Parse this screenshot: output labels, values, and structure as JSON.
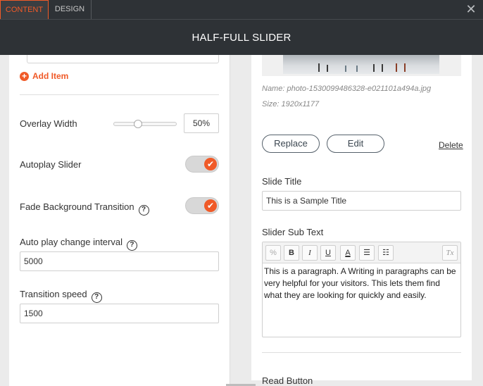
{
  "tabs": {
    "content": "CONTENT",
    "design": "DESIGN"
  },
  "window": {
    "close_glyph": "✕",
    "title": "HALF-FULL SLIDER"
  },
  "left": {
    "add_item": {
      "icon": "+",
      "label": "Add Item"
    },
    "overlay_width": {
      "label": "Overlay Width",
      "value": "50%",
      "level": 0.5
    },
    "autoplay": {
      "label": "Autoplay Slider",
      "on": true
    },
    "fade": {
      "label": "Fade Background Transition",
      "on": true
    },
    "interval": {
      "label": "Auto play change interval",
      "value": "5000"
    },
    "speed": {
      "label": "Transition speed",
      "value": "1500"
    },
    "help_glyph": "?",
    "check_glyph": "✔"
  },
  "right": {
    "image_name": "Name: photo-1530099486328-e021101a494a.jpg",
    "image_size": "Size: 1920x1177",
    "replace": "Replace",
    "edit": "Edit",
    "delete": "Delete",
    "slide_title_label": "Slide Title",
    "slide_title_value": "This is a Sample Title",
    "sub_text_label": "Slider Sub Text",
    "sub_text": "This is a paragraph. A Writing in paragraphs can be very helpful for your visitors. This lets them find what they are looking for quickly and easily.",
    "toolbar": {
      "link": "%",
      "bold": "B",
      "italic": "I",
      "underline": "U",
      "color": "A",
      "bullets": "☰",
      "numbers": "☷",
      "clear": "Tx"
    },
    "cut_off_label": "Read Button"
  },
  "colors": {
    "accent": "#f05a28",
    "header_bg": "#2e3236"
  }
}
